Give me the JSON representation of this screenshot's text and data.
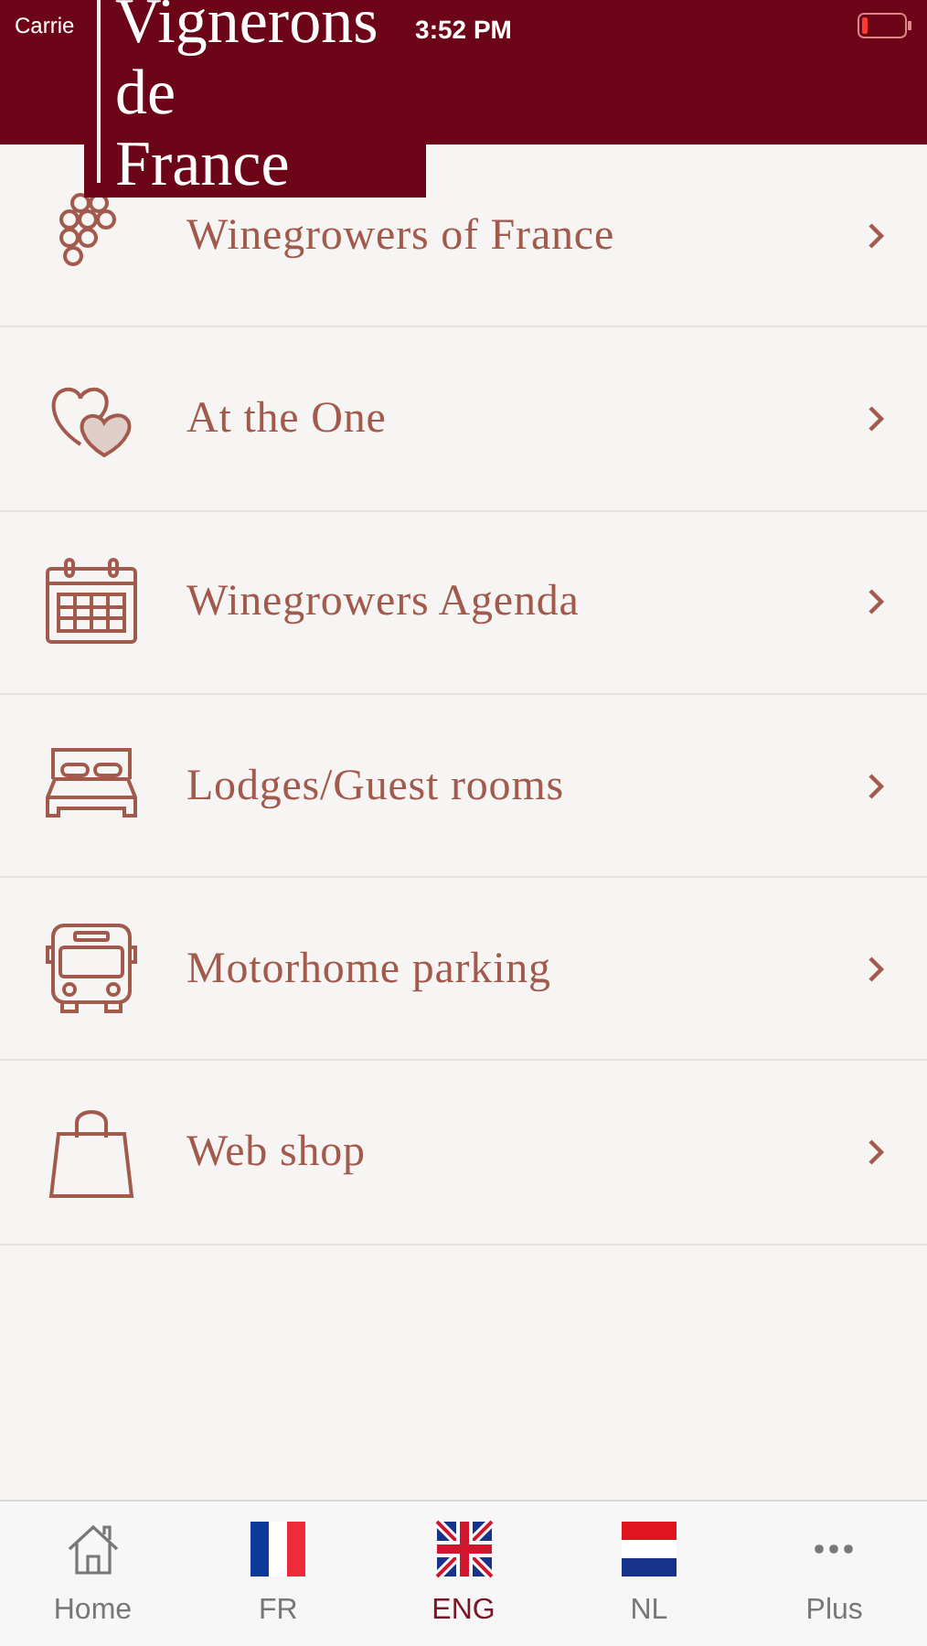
{
  "status_bar": {
    "carrier": "Carrie",
    "time": "3:52 PM"
  },
  "logo": {
    "lines": [
      "Vignerons",
      "de",
      "France"
    ]
  },
  "menu": [
    {
      "label": "Winegrowers of France"
    },
    {
      "label": "At the One"
    },
    {
      "label": "Winegrowers Agenda"
    },
    {
      "label": "Lodges/Guest rooms"
    },
    {
      "label": "Motorhome parking"
    },
    {
      "label": "Web shop"
    }
  ],
  "tab_bar": [
    {
      "label": "Home",
      "selected": false
    },
    {
      "label": "FR",
      "selected": false
    },
    {
      "label": "ENG",
      "selected": true
    },
    {
      "label": "NL",
      "selected": false
    },
    {
      "label": "Plus",
      "selected": false
    }
  ]
}
